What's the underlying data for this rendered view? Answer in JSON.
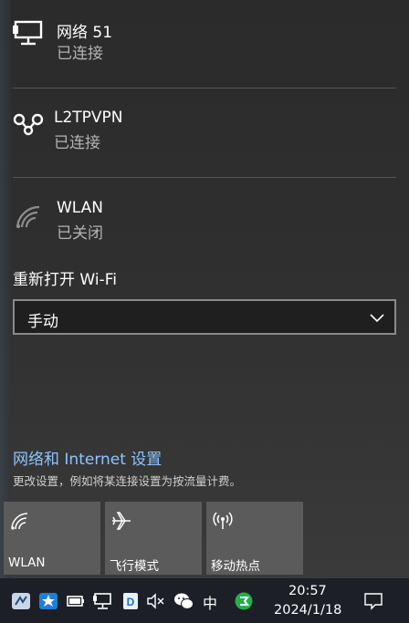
{
  "networks": [
    {
      "name": "网络 51",
      "status": "已连接",
      "icon": "ethernet-icon"
    },
    {
      "name": "L2TPVPN",
      "status": "已连接",
      "icon": "vpn-icon"
    },
    {
      "name": "WLAN",
      "status": "已关闭",
      "icon": "wifi-off-icon"
    }
  ],
  "wifi_reopen": {
    "label": "重新打开 Wi-Fi",
    "selected": "手动"
  },
  "settings": {
    "link": "网络和 Internet 设置",
    "description": "更改设置，例如将某连接设置为按流量计费。"
  },
  "quick_actions": [
    {
      "label": "WLAN",
      "icon": "wifi-icon"
    },
    {
      "label": "飞行模式",
      "icon": "airplane-icon"
    },
    {
      "label": "移动热点",
      "icon": "hotspot-icon"
    }
  ],
  "taskbar": {
    "time": "20:57",
    "date": "2024/1/18",
    "ime": "中"
  },
  "colors": {
    "link": "#8fc4ff",
    "tile": "#5b5b5b",
    "taskbar": "#1c2026"
  }
}
